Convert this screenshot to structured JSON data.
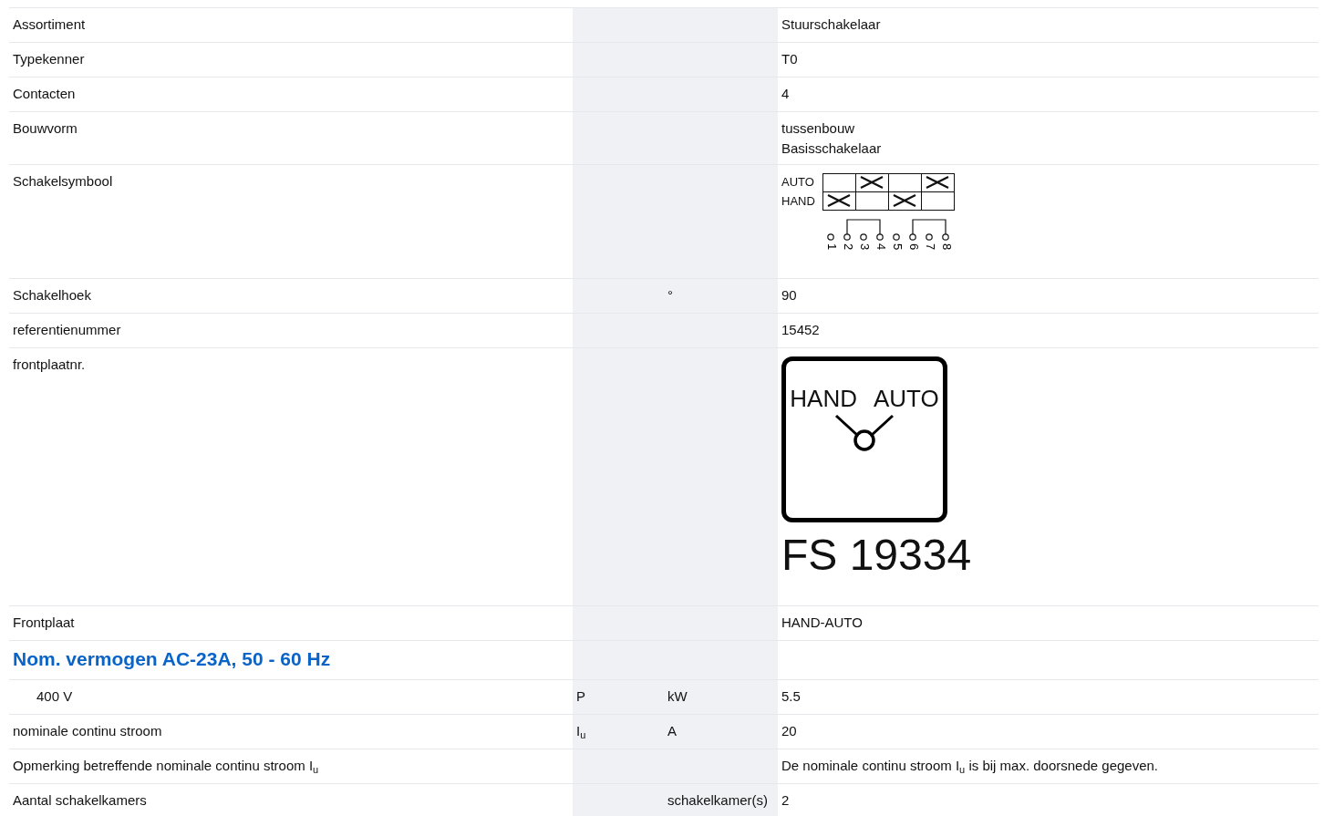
{
  "rows": [
    {
      "kind": "text",
      "label": "Assortiment",
      "values": [
        "Stuurschakelaar"
      ]
    },
    {
      "kind": "text",
      "label": "Typekenner",
      "values": [
        "T0"
      ]
    },
    {
      "kind": "text",
      "label": "Contacten",
      "values": [
        "4"
      ]
    },
    {
      "kind": "text",
      "label": "Bouwvorm",
      "values": [
        "tussenbouw",
        "Basisschakelaar"
      ]
    },
    {
      "kind": "switch_diagram",
      "label": "Schakelsymbool",
      "positions": [
        {
          "label": "AUTO",
          "crosses": [
            false,
            true,
            false,
            true
          ]
        },
        {
          "label": "HAND",
          "crosses": [
            true,
            false,
            true,
            false
          ]
        }
      ],
      "terminals": [
        "1",
        "2",
        "3",
        "4",
        "5",
        "6",
        "7",
        "8"
      ]
    },
    {
      "kind": "text",
      "label": "Schakelhoek",
      "unit": "°",
      "values": [
        "90"
      ]
    },
    {
      "kind": "text",
      "label": "referentienummer",
      "values": [
        "15452"
      ]
    },
    {
      "kind": "front_plate",
      "label": "frontplaatnr.",
      "dial": [
        "HAND",
        "AUTO"
      ],
      "code": "FS 19334"
    },
    {
      "kind": "text",
      "label": "Frontplaat",
      "values": [
        "HAND-AUTO"
      ]
    },
    {
      "kind": "heading",
      "label": "Nom. vermogen AC-23A, 50 - 60 Hz"
    },
    {
      "kind": "text",
      "label": "400 V",
      "indented": true,
      "symbol": "P",
      "unit": "kW",
      "values": [
        "5.5"
      ]
    },
    {
      "kind": "text",
      "label": "nominale continu stroom",
      "symbol": "I$_{u}$",
      "unit": "A",
      "values": [
        "20"
      ]
    },
    {
      "kind": "text",
      "label": "Opmerking betreffende nominale continu stroom I$_{u}$",
      "values": [
        "De nominale continu stroom I$_{u}$ is bij max. doorsnede gegeven."
      ]
    },
    {
      "kind": "text",
      "label": "Aantal schakelkamers",
      "unit": "schakelkamer(s)",
      "values": [
        "2"
      ]
    }
  ]
}
